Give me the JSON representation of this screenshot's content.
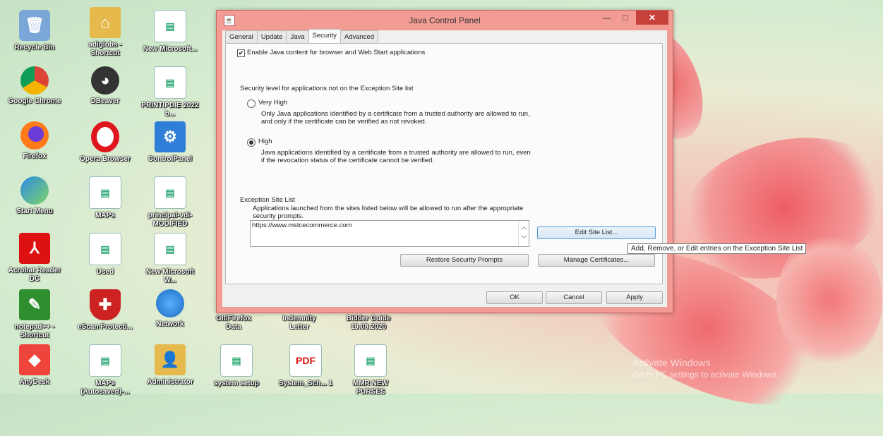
{
  "desktop": {
    "icons": [
      {
        "label": "Recycle Bin"
      },
      {
        "label": "adiglobs - Shortcut"
      },
      {
        "label": "New Microsoft..."
      },
      {
        "label": "Google Chrome"
      },
      {
        "label": "DBeaver"
      },
      {
        "label": "PRINTIPDIE 2022 b..."
      },
      {
        "label": "Firefox"
      },
      {
        "label": "Opera Browser"
      },
      {
        "label": "ControlPanel"
      },
      {
        "label": "Start Menu"
      },
      {
        "label": "MAPs"
      },
      {
        "label": "principal-vdi- MODIFIED"
      },
      {
        "label": "Acrobat Reader DC"
      },
      {
        "label": "Used"
      },
      {
        "label": "New Microsoft W..."
      },
      {
        "label": "notepad++ - Shortcut"
      },
      {
        "label": "eScan Protecti..."
      },
      {
        "label": "Network"
      },
      {
        "label": "GIt/Firefox Data"
      },
      {
        "label": "Indemnity Letter"
      },
      {
        "label": "Bidder Guide 19.08.2020"
      },
      {
        "label": "AnyDesk"
      },
      {
        "label": "MAPs (Autosaved)-..."
      },
      {
        "label": "Administrator"
      },
      {
        "label": "system setup"
      },
      {
        "label": "System_Sch... 1"
      },
      {
        "label": "MMR NEW PURSES"
      }
    ],
    "watermark_line1": "Activate Windows",
    "watermark_line2": "Go to PC settings to activate Windows."
  },
  "window": {
    "title": "Java Control Panel",
    "min": "—",
    "max": "□",
    "close": "✕",
    "tabs": [
      "General",
      "Update",
      "Java",
      "Security",
      "Advanced"
    ],
    "active_tab": "Security",
    "enable_label": "Enable Java content for browser and Web Start applications",
    "enable_checked": true,
    "security_level_label": "Security level for applications not on the Exception Site list",
    "very_high_label": "Very High",
    "very_high_desc1": "Only Java applications identified by a certificate from a trusted authority are allowed to run,",
    "very_high_desc2": "and only if the certificate can be verified as not revoked.",
    "high_label": "High",
    "high_desc1": "Java applications identified by a certificate from a trusted authority are allowed to run, even",
    "high_desc2": "if the revocation status of the certificate cannot be verified.",
    "selected_level": "High",
    "exception_title": "Exception Site List",
    "exception_desc1": "Applications launched from the sites listed below will be allowed to run after the appropriate",
    "exception_desc2": "security prompts.",
    "sites": [
      "https://www.mstcecommerce.com"
    ],
    "edit_site_list": "Edit Site List...",
    "restore_prompts": "Restore Security Prompts",
    "manage_certs": "Manage Certificates...",
    "ok": "OK",
    "cancel": "Cancel",
    "apply": "Apply"
  },
  "tooltip": "Add, Remove, or Edit entries on the Exception Site List"
}
